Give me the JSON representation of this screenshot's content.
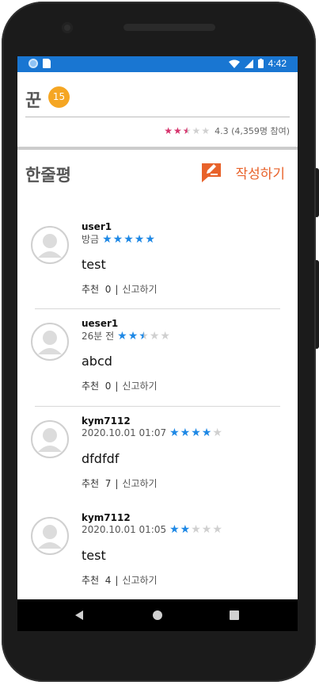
{
  "status_bar": {
    "time": "4:42"
  },
  "header": {
    "title": "꾼",
    "level_badge": "15",
    "rating_stars": 2.5,
    "rating_text": "4.3 (4,359명 참여)"
  },
  "reviews_section": {
    "title": "한줄평",
    "write_label": "작성하기",
    "items": [
      {
        "user": "user1",
        "time": "방금",
        "stars": 5,
        "content": "test",
        "recommend_label": "추천",
        "recommend_count": "0",
        "report_label": "신고하기"
      },
      {
        "user": "ueser1",
        "time": "26분 전",
        "stars": 2.5,
        "content": "abcd",
        "recommend_label": "추천",
        "recommend_count": "0",
        "report_label": "신고하기"
      },
      {
        "user": "kym7112",
        "time": "2020.10.01 01:07",
        "stars": 4,
        "content": "dfdfdf",
        "recommend_label": "추천",
        "recommend_count": "7",
        "report_label": "신고하기"
      },
      {
        "user": "kym7112",
        "time": "2020.10.01 01:05",
        "stars": 2,
        "content": "test",
        "recommend_label": "추천",
        "recommend_count": "4",
        "report_label": "신고하기"
      }
    ]
  },
  "colors": {
    "status_bar": "#1976d2",
    "accent": "#e8622a",
    "badge": "#f5a623",
    "star_header": "#d6336c",
    "star_review": "#1e88e5",
    "star_empty": "#d0d0d0"
  }
}
